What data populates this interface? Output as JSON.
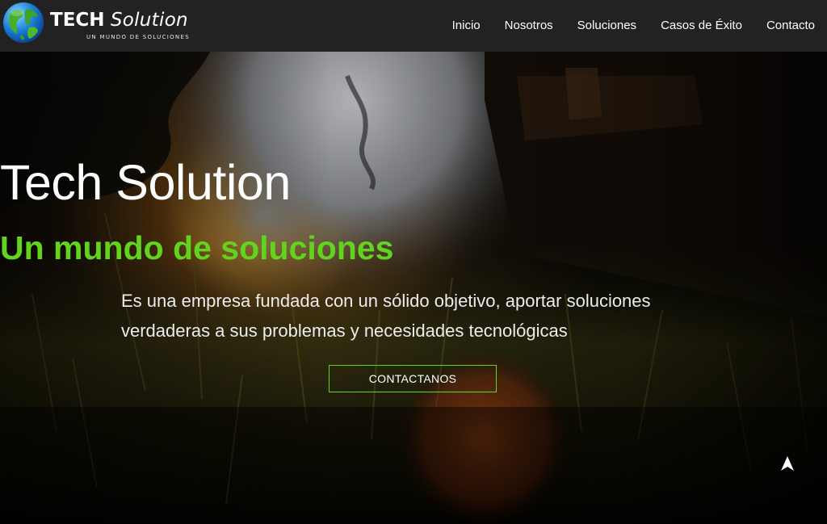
{
  "logo": {
    "title_bold": "TECH",
    "title_italic": "Solution",
    "tagline": "Un mundo de soluciones"
  },
  "nav": {
    "items": [
      "Inicio",
      "Nosotros",
      "Soluciones",
      "Casos de Éxito",
      "Contacto"
    ]
  },
  "hero": {
    "title": "Tech Solution",
    "subtitle": "Un mundo de soluciones",
    "description": "Es una empresa fundada con un sólido objetivo, aportar soluciones verdaderas a sus problemas y necesidades tecnológicas",
    "cta_label": "CONTACTANOS"
  },
  "colors": {
    "navbar": "#222222",
    "accent_green": "#62d41e",
    "text": "#ffffff"
  },
  "icons": {
    "logo": "globe-icon",
    "scroll": "navigation-arrow-icon"
  }
}
